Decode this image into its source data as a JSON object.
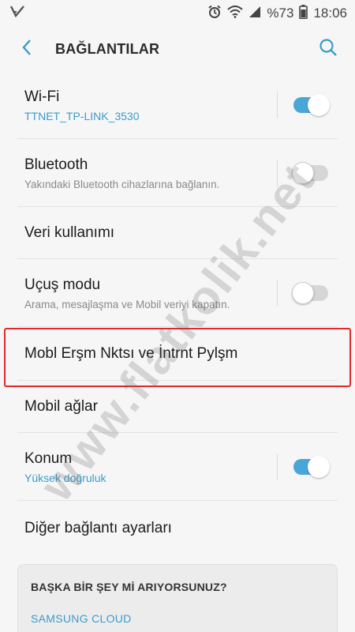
{
  "statusbar": {
    "battery_text": "%73",
    "time": "18:06",
    "icons": [
      "notification-check-icon",
      "alarm-icon",
      "wifi-icon",
      "signal-icon",
      "battery-icon"
    ]
  },
  "appbar": {
    "title": "BAĞLANTILAR",
    "back_icon": "back-arrow-icon",
    "search_icon": "search-icon"
  },
  "settings": {
    "wifi": {
      "label": "Wi-Fi",
      "sub": "TTNET_TP-LINK_3530",
      "toggle": "on"
    },
    "bluetooth": {
      "label": "Bluetooth",
      "sub": "Yakındaki Bluetooth cihazlarına bağlanın.",
      "toggle": "off"
    },
    "data_usage": {
      "label": "Veri kullanımı"
    },
    "airplane": {
      "label": "Uçuş modu",
      "sub": "Arama, mesajlaşma ve Mobil veriyi kapatın.",
      "toggle": "off"
    },
    "hotspot": {
      "label": "Mobl Erşm Nktsı ve İntrnt Pylşm"
    },
    "mobile_networks": {
      "label": "Mobil ağlar"
    },
    "location": {
      "label": "Konum",
      "sub": "Yüksek doğruluk",
      "toggle": "on"
    },
    "more": {
      "label": "Diğer bağlantı ayarları"
    }
  },
  "suggestion_card": {
    "title": "BAŞKA BİR ŞEY Mİ ARIYORSUNUZ?",
    "link": "SAMSUNG CLOUD"
  },
  "watermark": "www.flatkolik.net",
  "colors": {
    "accent": "#4aa6d6",
    "link": "#3a9cc9",
    "highlight": "#e12a2a"
  }
}
